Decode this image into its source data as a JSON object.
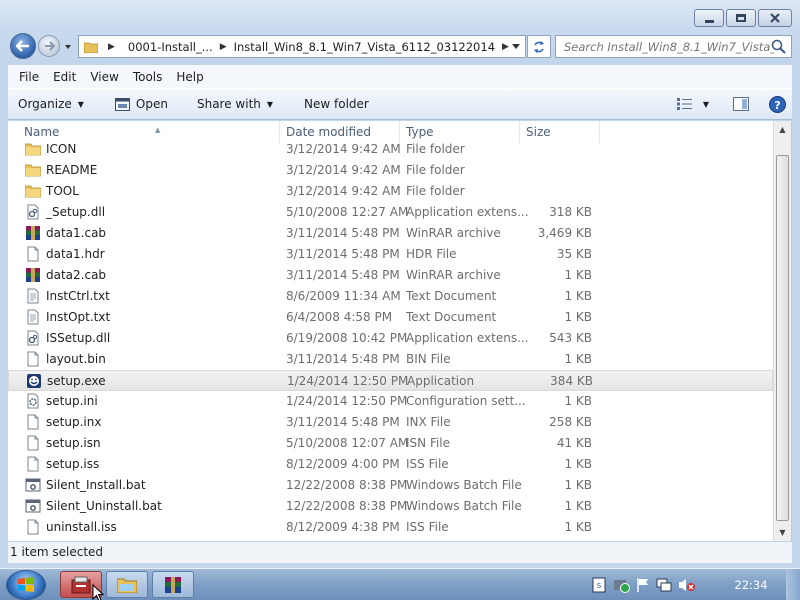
{
  "window": {
    "nav": {
      "breadcrumb": [
        "0001-Install_...",
        "Install_Win8_8.1_Win7_Vista_6112_03122014"
      ],
      "search_placeholder": "Search Install_Win8_8.1_Win7_Vista_6..."
    },
    "menu": [
      "File",
      "Edit",
      "View",
      "Tools",
      "Help"
    ],
    "commands": {
      "organize": "Organize",
      "open": "Open",
      "share_with": "Share with",
      "new_folder": "New folder"
    },
    "columns": {
      "name": "Name",
      "date_modified": "Date modified",
      "type": "Type",
      "size": "Size"
    },
    "files": [
      {
        "name": "ICON",
        "date": "3/12/2014 9:42 AM",
        "type": "File folder",
        "size": "",
        "icon": "folder-icon"
      },
      {
        "name": "README",
        "date": "3/12/2014 9:42 AM",
        "type": "File folder",
        "size": "",
        "icon": "folder-icon"
      },
      {
        "name": "TOOL",
        "date": "3/12/2014 9:42 AM",
        "type": "File folder",
        "size": "",
        "icon": "folder-icon"
      },
      {
        "name": "_Setup.dll",
        "date": "5/10/2008 12:27 AM",
        "type": "Application extens...",
        "size": "318 KB",
        "icon": "dll-icon"
      },
      {
        "name": "data1.cab",
        "date": "3/11/2014 5:48 PM",
        "type": "WinRAR archive",
        "size": "3,469 KB",
        "icon": "winrar-icon"
      },
      {
        "name": "data1.hdr",
        "date": "3/11/2014 5:48 PM",
        "type": "HDR File",
        "size": "35 KB",
        "icon": "file-icon"
      },
      {
        "name": "data2.cab",
        "date": "3/11/2014 5:48 PM",
        "type": "WinRAR archive",
        "size": "1 KB",
        "icon": "winrar-icon"
      },
      {
        "name": "InstCtrl.txt",
        "date": "8/6/2009 11:34 AM",
        "type": "Text Document",
        "size": "1 KB",
        "icon": "text-icon"
      },
      {
        "name": "InstOpt.txt",
        "date": "6/4/2008 4:58 PM",
        "type": "Text Document",
        "size": "1 KB",
        "icon": "text-icon"
      },
      {
        "name": "ISSetup.dll",
        "date": "6/19/2008 10:42 PM",
        "type": "Application extens...",
        "size": "543 KB",
        "icon": "dll-icon"
      },
      {
        "name": "layout.bin",
        "date": "3/11/2014 5:48 PM",
        "type": "BIN File",
        "size": "1 KB",
        "icon": "file-icon"
      },
      {
        "name": "setup.exe",
        "date": "1/24/2014 12:50 PM",
        "type": "Application",
        "size": "384 KB",
        "icon": "setup-exe-icon",
        "selected": true
      },
      {
        "name": "setup.ini",
        "date": "1/24/2014 12:50 PM",
        "type": "Configuration sett...",
        "size": "1 KB",
        "icon": "config-icon"
      },
      {
        "name": "setup.inx",
        "date": "3/11/2014 5:48 PM",
        "type": "INX File",
        "size": "258 KB",
        "icon": "file-icon"
      },
      {
        "name": "setup.isn",
        "date": "5/10/2008 12:07 AM",
        "type": "ISN File",
        "size": "41 KB",
        "icon": "file-icon"
      },
      {
        "name": "setup.iss",
        "date": "8/12/2009 4:00 PM",
        "type": "ISS File",
        "size": "1 KB",
        "icon": "file-icon"
      },
      {
        "name": "Silent_Install.bat",
        "date": "12/22/2008 8:38 PM",
        "type": "Windows Batch File",
        "size": "1 KB",
        "icon": "batch-icon"
      },
      {
        "name": "Silent_Uninstall.bat",
        "date": "12/22/2008 8:38 PM",
        "type": "Windows Batch File",
        "size": "1 KB",
        "icon": "batch-icon"
      },
      {
        "name": "uninstall.iss",
        "date": "8/12/2009 4:38 PM",
        "type": "ISS File",
        "size": "1 KB",
        "icon": "file-icon"
      }
    ],
    "status": "1 item selected"
  },
  "taskbar": {
    "clock": "22:34"
  }
}
